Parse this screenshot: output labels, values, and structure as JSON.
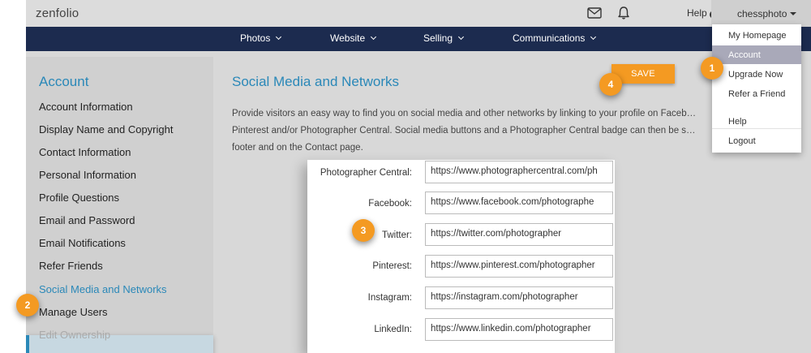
{
  "header": {
    "logo": "zenfolio",
    "help_label": "Help",
    "help_icon": "question-circle-icon",
    "username": "chessphoto",
    "icons": [
      "mail-icon",
      "bell-icon"
    ]
  },
  "nav": {
    "items": [
      {
        "label": "Photos"
      },
      {
        "label": "Website"
      },
      {
        "label": "Selling"
      },
      {
        "label": "Communications"
      }
    ]
  },
  "sidebar": {
    "title": "Account",
    "items": [
      {
        "label": "Account Information"
      },
      {
        "label": "Display Name and Copyright"
      },
      {
        "label": "Contact Information"
      },
      {
        "label": "Personal Information"
      },
      {
        "label": "Profile Questions"
      },
      {
        "label": "Email and Password"
      },
      {
        "label": "Email Notifications"
      },
      {
        "label": "Refer Friends"
      },
      {
        "label": "Social Media and Networks",
        "active": true
      },
      {
        "label": "Manage Users"
      },
      {
        "label": "Edit Ownership"
      }
    ]
  },
  "main": {
    "title": "Social Media and Networks",
    "save_label": "SAVE",
    "description": "Provide visitors an easy way to find you on social media and other networks by linking to your profile on Faceb… Pinterest and/or Photographer Central. Social media buttons and a Photographer Central badge can then be s… footer and on the Contact page.",
    "fields": [
      {
        "label": "Photographer Central:",
        "value": "https://www.photographercentral.com/ph"
      },
      {
        "label": "Facebook:",
        "value": "https://www.facebook.com/photographe"
      },
      {
        "label": "Twitter:",
        "value": "https://twitter.com/photographer"
      },
      {
        "label": "Pinterest:",
        "value": "https://www.pinterest.com/photographer"
      },
      {
        "label": "Instagram:",
        "value": "https://instagram.com/photographer"
      },
      {
        "label": "LinkedIn:",
        "value": "https://www.linkedin.com/photographer"
      }
    ]
  },
  "user_dropdown": {
    "items": [
      {
        "label": "My Homepage"
      },
      {
        "label": "Account",
        "active": true
      },
      {
        "label": "Upgrade Now"
      },
      {
        "label": "Refer a Friend"
      },
      {
        "label": "Help"
      },
      {
        "label": "Logout"
      }
    ]
  },
  "callouts": [
    "1",
    "2",
    "3",
    "4"
  ],
  "colors": {
    "nav_bg": "#1c2b4f",
    "accent_blue": "#2a88b8",
    "accent_orange": "#f49a22",
    "dropdown_active": "#a9a9b9"
  }
}
